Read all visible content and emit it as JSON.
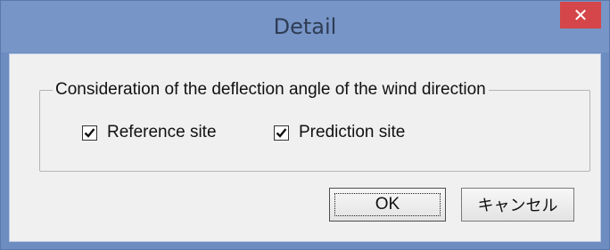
{
  "dialog": {
    "title": "Detail",
    "close_glyph": "✕",
    "close_icon": "close-icon"
  },
  "groupbox": {
    "legend": "Consideration of the deflection angle of the wind direction",
    "options": [
      {
        "label": "Reference site",
        "checked": true,
        "icon": "checkmark-icon"
      },
      {
        "label": "Prediction site",
        "checked": true,
        "icon": "checkmark-icon"
      }
    ]
  },
  "buttons": {
    "ok_label": "OK",
    "cancel_label": "キャンセル"
  },
  "colors": {
    "frame": "#7795c6",
    "close": "#d5464a",
    "client": "#f0f0f0"
  }
}
